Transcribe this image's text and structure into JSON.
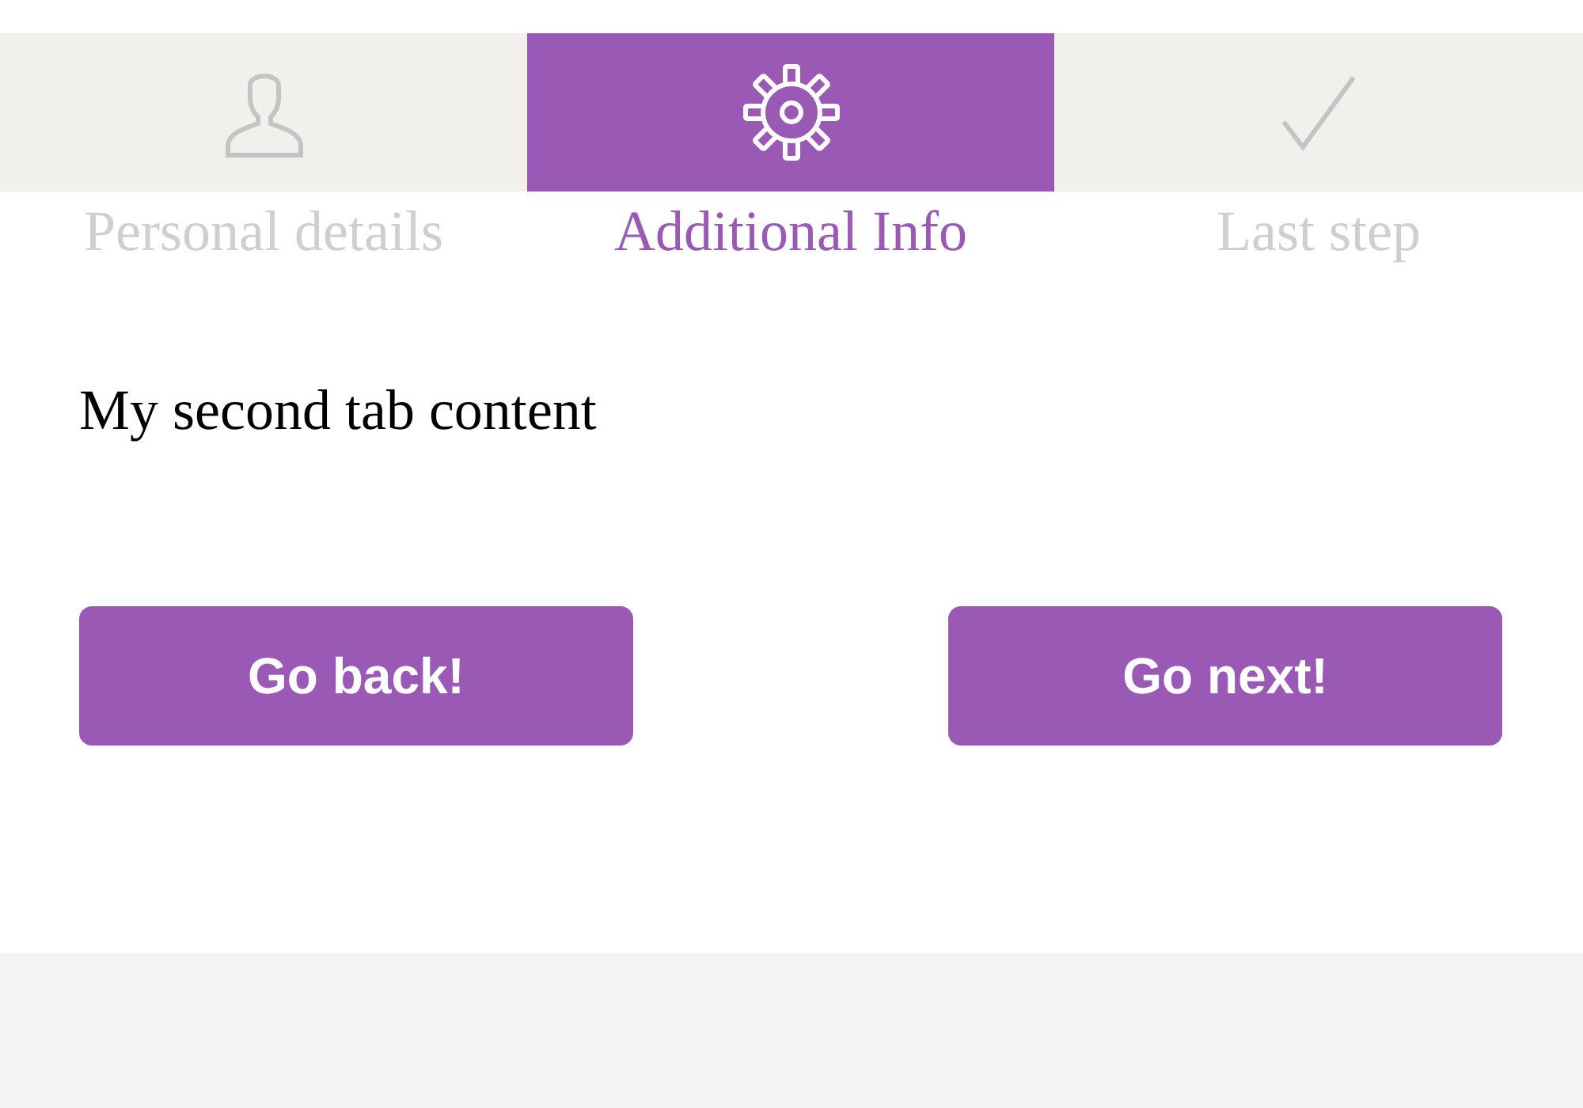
{
  "tabs": [
    {
      "label": "Personal details",
      "selected": false
    },
    {
      "label": "Additional Info",
      "selected": true
    },
    {
      "label": "Last step",
      "selected": false
    }
  ],
  "content": {
    "text": "My second tab content"
  },
  "buttons": [
    {
      "label": "Go back!"
    },
    {
      "label": "Go next!"
    }
  ]
}
